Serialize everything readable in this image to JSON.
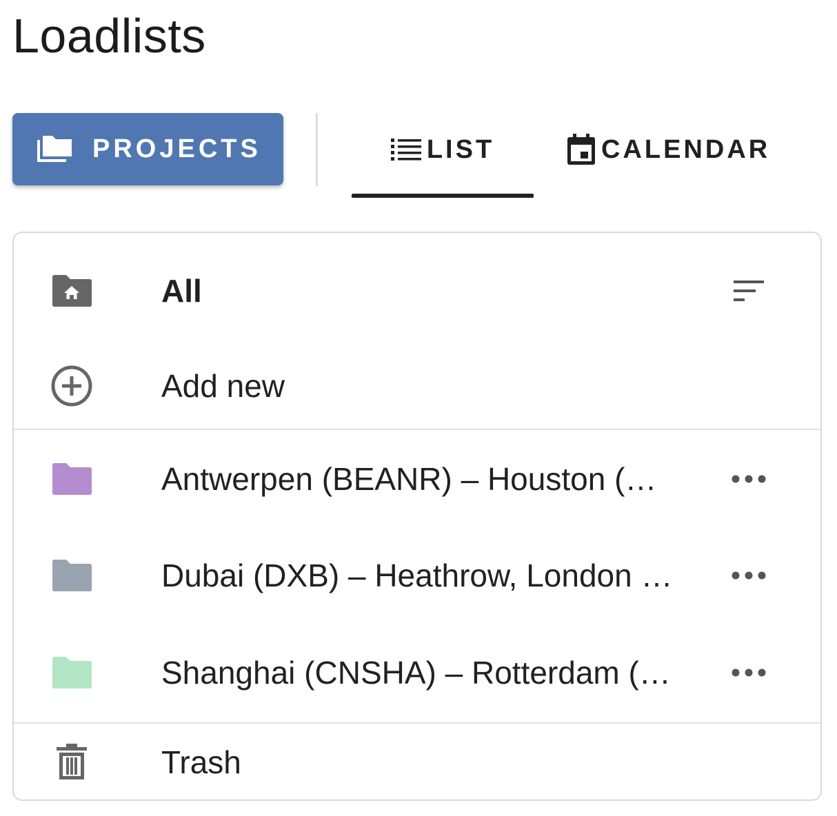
{
  "page": {
    "title": "Loadlists"
  },
  "toolbar": {
    "projects_label": "PROJECTS",
    "projects_color": "#5077b1",
    "tabs": [
      {
        "label": "LIST",
        "icon": "list-icon",
        "active": true
      },
      {
        "label": "CALENDAR",
        "icon": "calendar-icon",
        "active": false
      }
    ]
  },
  "panel": {
    "all": {
      "label": "All",
      "icon": "folder-home-icon",
      "action_icon": "sort-icon"
    },
    "add_new": {
      "label": "Add new",
      "icon": "add-circle-icon"
    },
    "projects": [
      {
        "label": "Antwerpen (BEANR) – Houston (…",
        "color": "#b48ccf",
        "action_icon": "more-horiz-icon"
      },
      {
        "label": "Dubai (DXB) – Heathrow, London …",
        "color": "#9aa3b0",
        "action_icon": "more-horiz-icon"
      },
      {
        "label": "Shanghai (CNSHA) – Rotterdam (…",
        "color": "#b2e5c4",
        "action_icon": "more-horiz-icon"
      }
    ],
    "trash": {
      "label": "Trash",
      "icon": "trash-icon"
    }
  }
}
